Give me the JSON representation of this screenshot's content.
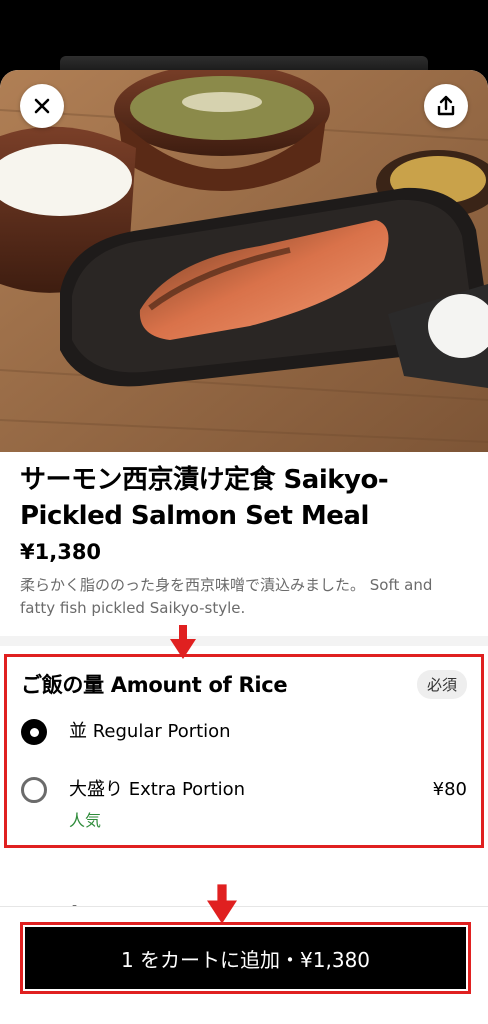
{
  "header": {
    "close_icon": "close-icon",
    "share_icon": "share-icon"
  },
  "item": {
    "title": "サーモン西京漬け定食 Saikyo-Pickled Salmon Set Meal",
    "price": "¥1,380",
    "description": "柔らかく脂ののった身を西京味噌で漬込みました。 Soft and fatty fish pickled Saikyo-style."
  },
  "options": {
    "title": "ご飯の量 Amount of Rice",
    "required_badge": "必須",
    "choices": [
      {
        "label": "並 Regular Portion",
        "selected": true,
        "price": "",
        "tag": ""
      },
      {
        "label": "大盛り Extra Portion",
        "selected": false,
        "price": "¥80",
        "tag": "人気"
      }
    ]
  },
  "cart": {
    "button_label": "1 をカートに追加・¥1,380"
  },
  "colors": {
    "annotation_red": "#e02020",
    "popular_green": "#2e8b3a",
    "button_black": "#000000"
  }
}
